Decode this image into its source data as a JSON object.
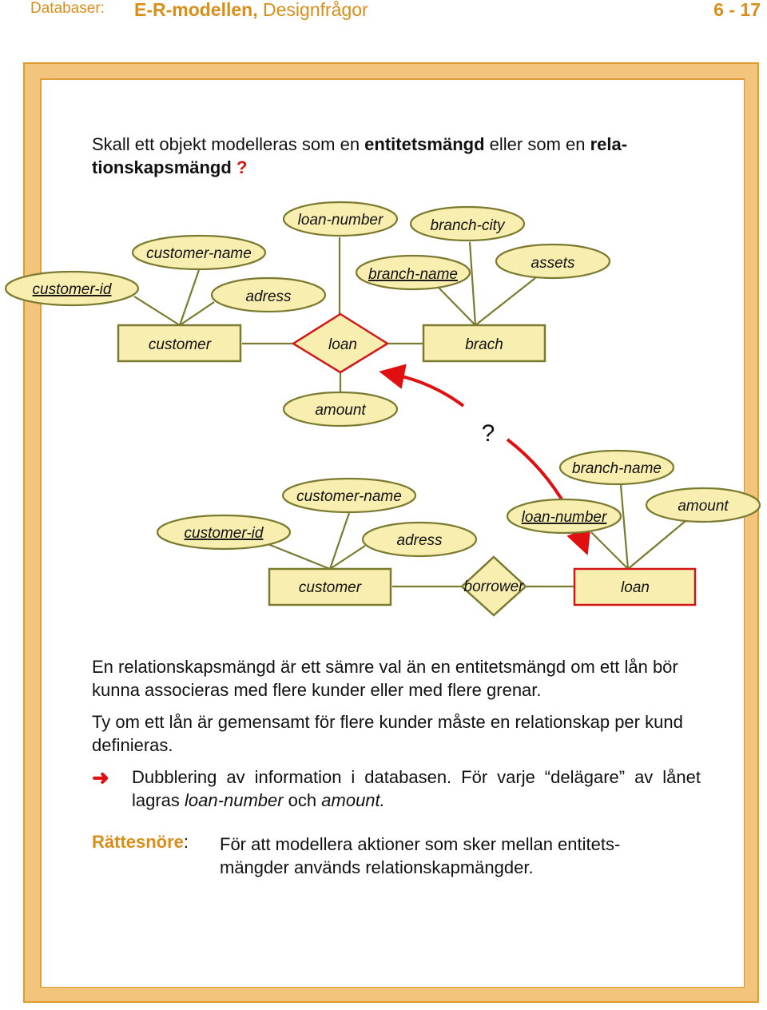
{
  "header": {
    "course": "Databaser:",
    "title_bold": "E-R-modellen,",
    "title_rest": " Designfrågor",
    "page": "6 - 17"
  },
  "intro": {
    "part1": "Skall ett objekt modelleras som en ",
    "bold1": "entitetsmängd",
    "part2": " eller som en ",
    "bold2": "rela-",
    "bold3": "tionskapsmängd",
    "question": "?"
  },
  "colors": {
    "accent": "#d98e1a",
    "frame": "#f2c47c",
    "shape_fill": "#f8eeb0",
    "shape_stroke": "#7a7a30",
    "highlight": "#d01818"
  },
  "diagram_top": {
    "entities": [
      {
        "id": "customer",
        "label": "customer",
        "highlight": false
      },
      {
        "id": "brach",
        "label": "brach",
        "highlight": false
      }
    ],
    "relationship": {
      "id": "loan",
      "label": "loan",
      "highlight": true
    },
    "attributes": [
      {
        "label": "customer-id",
        "key": true,
        "of": "customer"
      },
      {
        "label": "customer-name",
        "key": false,
        "of": "customer"
      },
      {
        "label": "adress",
        "key": false,
        "of": "customer"
      },
      {
        "label": "loan-number",
        "key": false,
        "of": "loan"
      },
      {
        "label": "branch-city",
        "key": false,
        "of": "brach"
      },
      {
        "label": "branch-name",
        "key": true,
        "of": "brach"
      },
      {
        "label": "assets",
        "key": false,
        "of": "brach"
      },
      {
        "label": "amount",
        "key": false,
        "of": "loan"
      }
    ]
  },
  "diagram_question": "?",
  "diagram_bottom": {
    "entities": [
      {
        "id": "customer",
        "label": "customer",
        "highlight": false
      },
      {
        "id": "loan",
        "label": "loan",
        "highlight": true
      }
    ],
    "relationship": {
      "id": "borrower",
      "label": "borrower",
      "highlight": false
    },
    "attributes": [
      {
        "label": "customer-id",
        "key": true,
        "of": "customer"
      },
      {
        "label": "customer-name",
        "key": false,
        "of": "customer"
      },
      {
        "label": "adress",
        "key": false,
        "of": "customer"
      },
      {
        "label": "branch-name",
        "key": false,
        "of": "loan"
      },
      {
        "label": "loan-number",
        "key": true,
        "of": "loan"
      },
      {
        "label": "amount",
        "key": false,
        "of": "loan"
      }
    ]
  },
  "body": {
    "para1": "En relationskapsmängd är ett sämre val än en entitetsmängd om ett lån bör kunna associeras med flere kunder eller med flere grenar.",
    "para2": "Ty om ett lån är gemensamt för flere kunder måste en relationskap per kund definieras.",
    "bullet_icon": "right-arrow-icon",
    "bullet_text1": "Dubblering av information i databasen. För varje “delägare” av lånet lagras ",
    "bullet_em1": "loan-number",
    "bullet_text2": " och ",
    "bullet_em2": "amount.",
    "guide_label": "Rättesnöre",
    "guide_colon": ":",
    "guide_text1": "För att modellera aktioner som sker mellan entitets-",
    "guide_text2": "mängder används relationskapmängder."
  }
}
